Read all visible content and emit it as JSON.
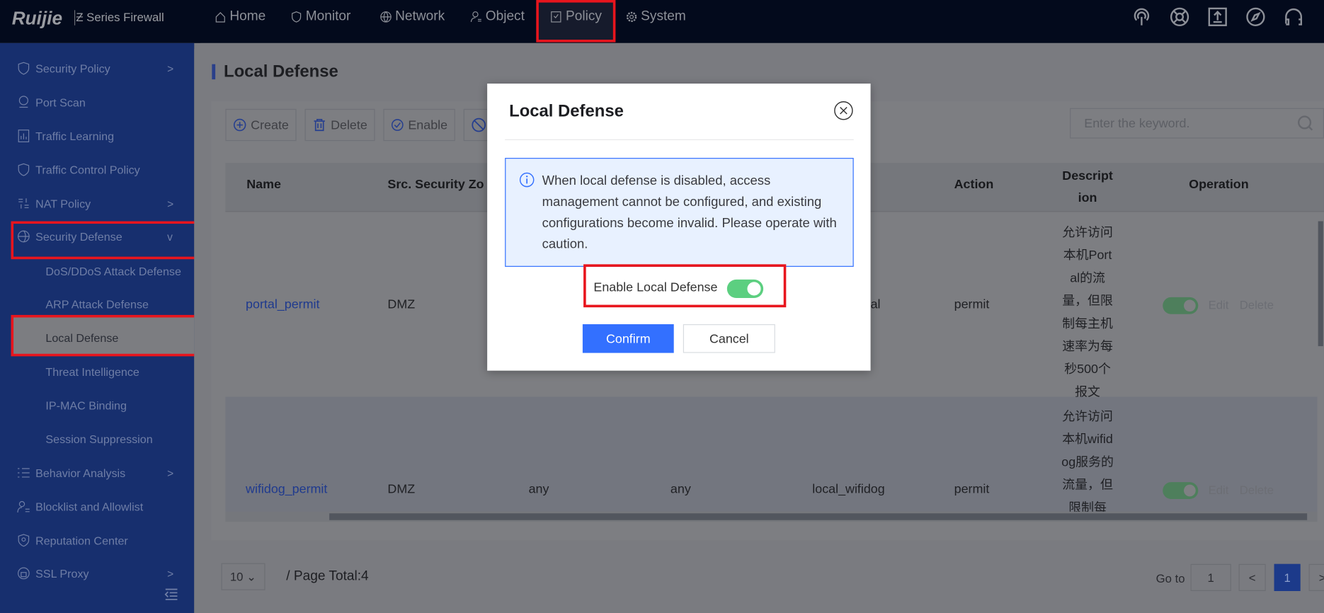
{
  "brand": {
    "logo": "Ruijie",
    "product": "Series Firewall"
  },
  "topnav": [
    {
      "label": "Home",
      "icon": "home-icon"
    },
    {
      "label": "Monitor",
      "icon": "shield-icon"
    },
    {
      "label": "Network",
      "icon": "globe-icon"
    },
    {
      "label": "Object",
      "icon": "user-icon"
    },
    {
      "label": "Policy",
      "icon": "policy-icon",
      "active": true
    },
    {
      "label": "System",
      "icon": "gear-icon"
    }
  ],
  "header_icons": [
    "antenna-icon",
    "lifebuoy-icon",
    "upload-icon",
    "compass-icon",
    "headset-icon",
    "user-icon"
  ],
  "sidebar": {
    "items": [
      {
        "label": "Security Policy",
        "chevron": ">"
      },
      {
        "label": "Port Scan"
      },
      {
        "label": "Traffic Learning"
      },
      {
        "label": "Traffic Control Policy"
      },
      {
        "label": "NAT Policy",
        "chevron": ">"
      },
      {
        "label": "Security Defense",
        "chevron": "v"
      }
    ],
    "sub_items": [
      "DoS/DDoS Attack Defense",
      "ARP Attack Defense",
      "Local Defense",
      "Threat Intelligence",
      "IP-MAC Binding",
      "Session Suppression"
    ],
    "more_items": [
      {
        "label": "Behavior Analysis",
        "chevron": ">"
      },
      {
        "label": "Blocklist and Allowlist"
      },
      {
        "label": "Reputation Center"
      },
      {
        "label": "SSL Proxy",
        "chevron": ">"
      }
    ]
  },
  "page": {
    "title": "Local Defense"
  },
  "toolbar": {
    "create": "Create",
    "delete": "Delete",
    "enable": "Enable",
    "search_placeholder": "Enter the keyword."
  },
  "table": {
    "headers": [
      "Name",
      "Src. Security Zo",
      "Action",
      "Descript ion",
      "Operation"
    ],
    "rows": [
      {
        "name": "portal_permit",
        "src": "DMZ",
        "col5": "al",
        "action": "permit",
        "desc": "允许访问本机Portal的流量，但限制每主机速率为每秒500个报文",
        "edit": "Edit",
        "delete": "Delete",
        "enabled": true
      },
      {
        "name": "wifidog_permit",
        "src": "DMZ",
        "c3": "any",
        "c4": "any",
        "col5": "local_wifidog",
        "action": "permit",
        "desc": "允许访问本机wifidog服务的流量，但限制每",
        "edit": "Edit",
        "delete": "Delete",
        "enabled": true
      }
    ]
  },
  "pagination": {
    "page_size": "10",
    "total": "/ Page Total:4",
    "goto_label": "Go to",
    "goto_value": "1",
    "current": "1",
    "prev": "<",
    "next": ">"
  },
  "modal": {
    "title": "Local Defense",
    "info": "When local defense is disabled, access management cannot be configured, and existing configurations become invalid. Please operate with caution.",
    "toggle_label": "Enable Local Defense",
    "toggle_on": true,
    "confirm": "Confirm",
    "cancel": "Cancel"
  },
  "colors": {
    "primary": "#3370ff",
    "toggle_on": "#5ccf80",
    "highlight": "#e8151d"
  }
}
